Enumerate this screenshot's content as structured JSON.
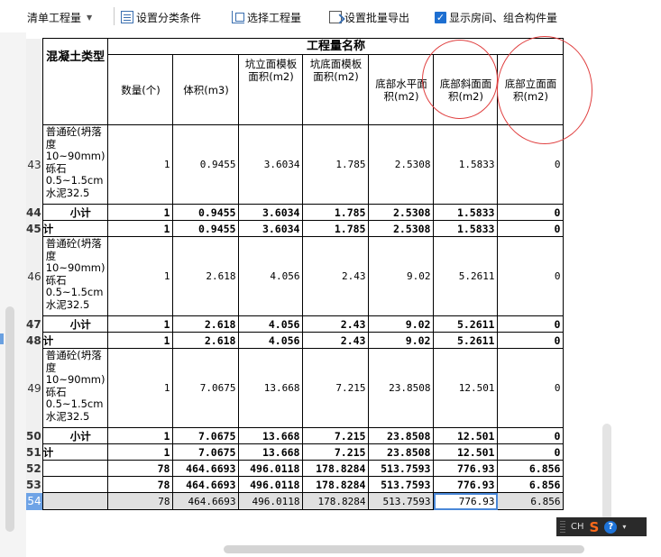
{
  "toolbar": {
    "combo_label": "清单工程量",
    "filter_label": "设置分类条件",
    "select_label": "选择工程量",
    "export_label": "设置批量导出",
    "show_rooms_label": "显示房间、组合构件量",
    "show_rooms_checked": true
  },
  "table": {
    "group_header": "工程量名称",
    "type_header": "混凝土类型",
    "columns": [
      "数量(个)",
      "体积(m3)",
      "坑立面模板面积(m2)",
      "坑底面模板面积(m2)",
      "底部水平面积(m2)",
      "底部斜面面积(m2)",
      "底部立面面积(m2)"
    ],
    "rows": [
      {
        "rn": "43",
        "kind": "detail",
        "type": "普通砼(坍落度10~90mm) 砾石0.5~1.5cm 水泥32.5",
        "values": [
          "1",
          "0.9455",
          "3.6034",
          "1.785",
          "2.5308",
          "1.5833",
          "0"
        ]
      },
      {
        "rn": "44",
        "kind": "subtotal",
        "type": "小计",
        "values": [
          "1",
          "0.9455",
          "3.6034",
          "1.785",
          "2.5308",
          "1.5833",
          "0"
        ]
      },
      {
        "rn": "45",
        "kind": "total",
        "type": "计",
        "values": [
          "1",
          "0.9455",
          "3.6034",
          "1.785",
          "2.5308",
          "1.5833",
          "0"
        ]
      },
      {
        "rn": "46",
        "kind": "detail",
        "type": "普通砼(坍落度10~90mm) 砾石0.5~1.5cm 水泥32.5",
        "values": [
          "1",
          "2.618",
          "4.056",
          "2.43",
          "9.02",
          "5.2611",
          "0"
        ]
      },
      {
        "rn": "47",
        "kind": "subtotal",
        "type": "小计",
        "values": [
          "1",
          "2.618",
          "4.056",
          "2.43",
          "9.02",
          "5.2611",
          "0"
        ]
      },
      {
        "rn": "48",
        "kind": "total",
        "type": "计",
        "values": [
          "1",
          "2.618",
          "4.056",
          "2.43",
          "9.02",
          "5.2611",
          "0"
        ]
      },
      {
        "rn": "49",
        "kind": "detail",
        "type": "普通砼(坍落度10~90mm) 砾石0.5~1.5cm 水泥32.5",
        "values": [
          "1",
          "7.0675",
          "13.668",
          "7.215",
          "23.8508",
          "12.501",
          "0"
        ]
      },
      {
        "rn": "50",
        "kind": "subtotal",
        "type": "小计",
        "values": [
          "1",
          "7.0675",
          "13.668",
          "7.215",
          "23.8508",
          "12.501",
          "0"
        ]
      },
      {
        "rn": "51",
        "kind": "total",
        "type": "计",
        "values": [
          "1",
          "7.0675",
          "13.668",
          "7.215",
          "23.8508",
          "12.501",
          "0"
        ]
      },
      {
        "rn": "52",
        "kind": "grand",
        "type": "",
        "values": [
          "78",
          "464.6693",
          "496.0118",
          "178.8284",
          "513.7593",
          "776.93",
          "6.856"
        ]
      },
      {
        "rn": "53",
        "kind": "grand",
        "type": "",
        "values": [
          "78",
          "464.6693",
          "496.0118",
          "178.8284",
          "513.7593",
          "776.93",
          "6.856"
        ]
      },
      {
        "rn": "54",
        "kind": "selected",
        "type": "",
        "values": [
          "78",
          "464.6693",
          "496.0118",
          "178.8284",
          "513.7593",
          "776.93",
          "6.856"
        ]
      }
    ]
  },
  "ime": {
    "lang": "CH",
    "s_glyph": "S",
    "help_glyph": "?"
  },
  "colors": {
    "annotation_circle": "#e04040",
    "selection": "#6ea3e6",
    "checkbox": "#1d6fd1"
  }
}
